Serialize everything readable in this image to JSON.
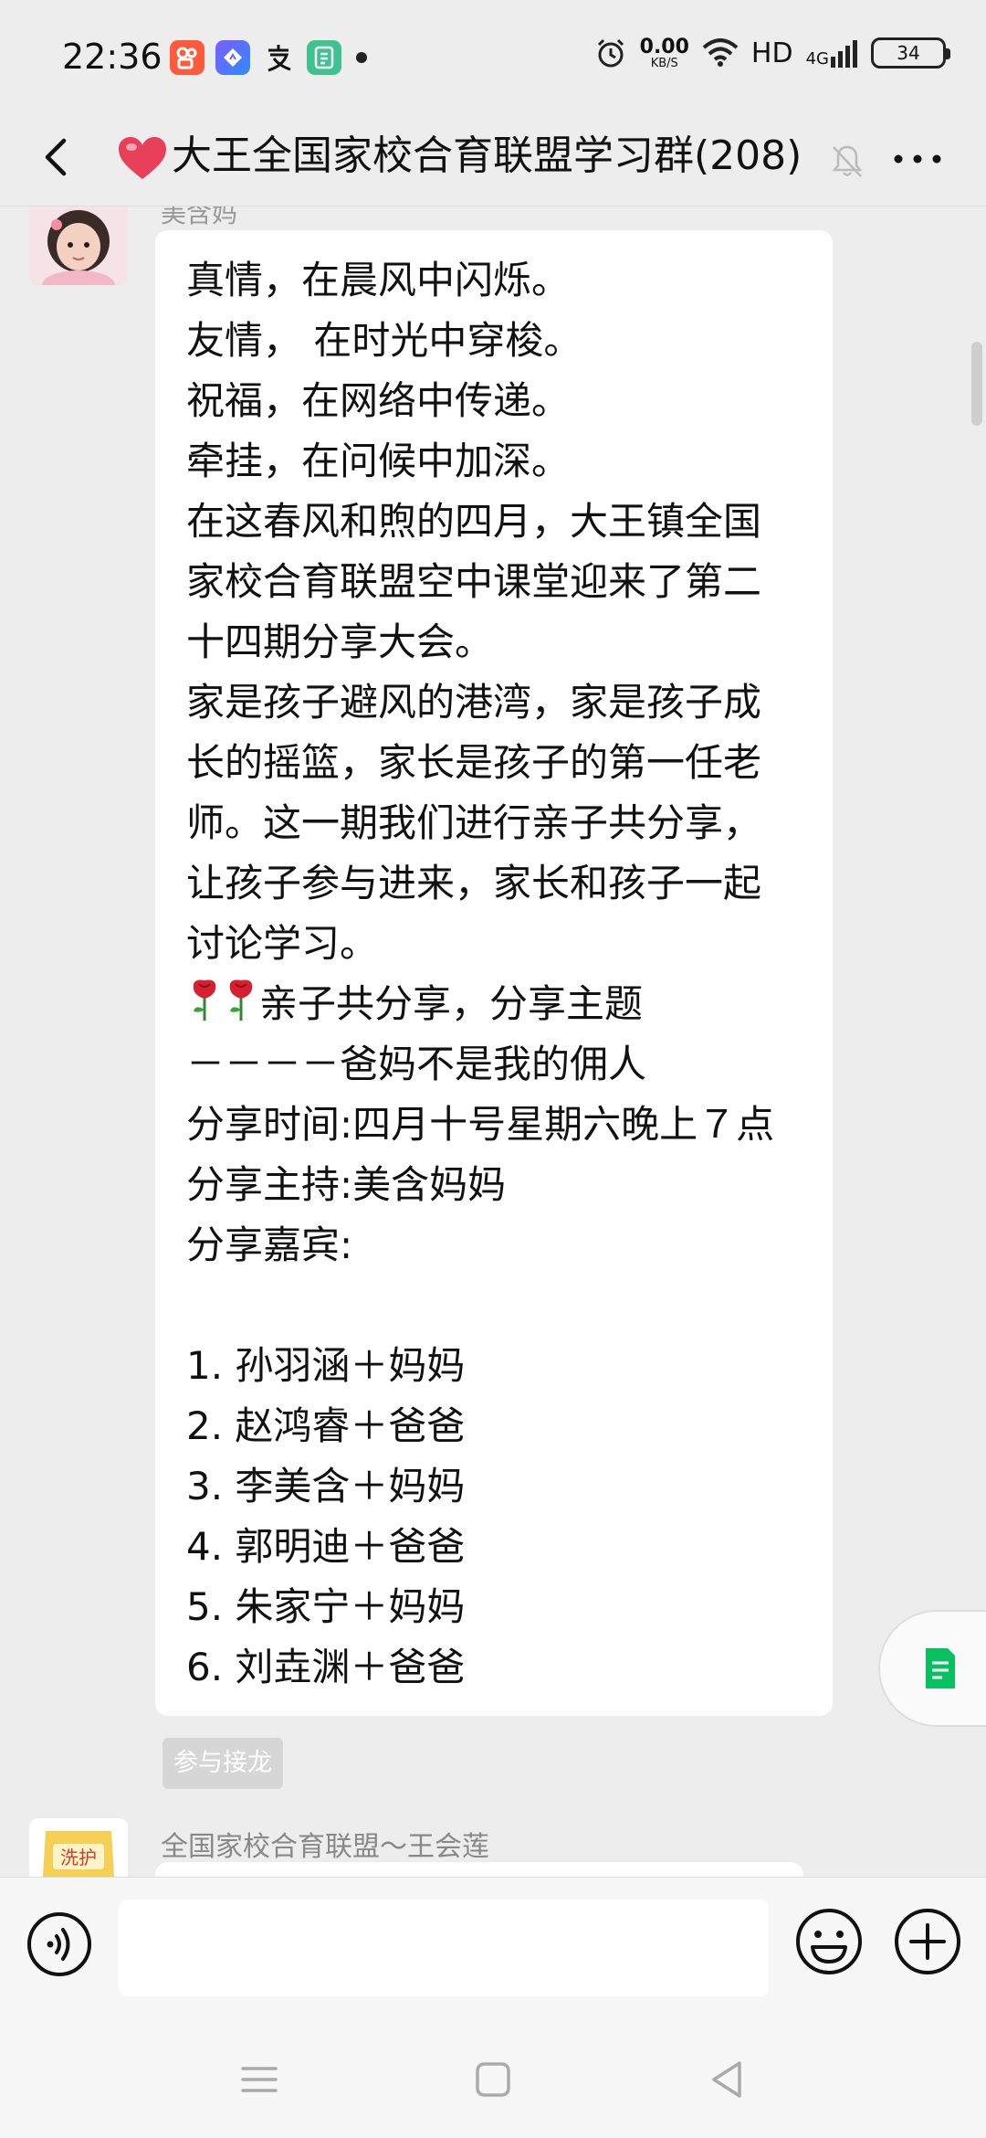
{
  "status_bar": {
    "time": "22:36",
    "network_speed_value": "0.00",
    "network_speed_unit": "KB/S",
    "hd_label": "HD",
    "network_type": "4G",
    "battery_level": "34",
    "app_icons": [
      "kuaishou-icon",
      "navigation-app-icon",
      "alipay-icon",
      "green-app-icon"
    ],
    "notification_dot": "•"
  },
  "nav": {
    "title": "大王全国家校合育联盟学习群(208)",
    "muted": true
  },
  "messages": [
    {
      "sender": "美含妈",
      "lines": [
        "真情，在晨风中闪烁。",
        "友情，  在时光中穿梭。",
        "祝福，在网络中传递。",
        "牵挂，在问候中加深。",
        "在这春风和煦的四月，大王镇全国",
        "家校合育联盟空中课堂迎来了第二",
        "十四期分享大会。",
        "家是孩子避风的港湾，家是孩子成",
        "长的摇篮，家长是孩子的第一任老",
        "师。这一期我们进行亲子共分享，",
        "让孩子参与进来，家长和孩子一起",
        "讨论学习。",
        "亲子共分享，分享主题",
        "－－－－爸妈不是我的佣人",
        "分享时间:四月十号星期六晚上７点",
        "分享主持:美含妈妈",
        "分享嘉宾:",
        "",
        "1. 孙羽涵＋妈妈",
        "2. 赵鸿睿＋爸爸",
        "3. 李美含＋妈妈",
        "4. 郭明迪＋爸爸",
        "5. 朱家宁＋妈妈",
        "6. 刘垚渊＋爸爸"
      ],
      "action_tag": "参与接龙"
    },
    {
      "sender": "全国家校合育联盟～王会莲",
      "avatar_text": "洗护"
    }
  ],
  "input": {
    "placeholder": "",
    "value": ""
  },
  "colors": {
    "background": "#ededed",
    "bubble": "#ffffff",
    "accent_green": "#07c160",
    "heart": "#e8405a"
  }
}
